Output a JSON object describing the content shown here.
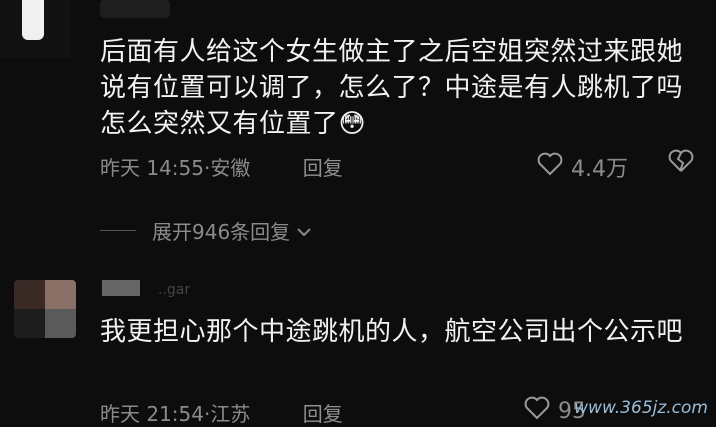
{
  "comment1": {
    "text": "后面有人给这个女生做主了之后空姐突然过来跟她说有位置可以调了，怎么了？中途是有人跳机了吗怎么突然又有位置了",
    "emoji": "😳",
    "time": "昨天 14:55",
    "location": "安徽",
    "reply_label": "回复",
    "likes": "4.4万"
  },
  "expand": {
    "label": "展开946条回复"
  },
  "comment2": {
    "username_fragment": "..gar",
    "text": "我更担心那个中途跳机的人，航空公司出个公示吧",
    "time": "昨天 21:54",
    "location": "江苏",
    "reply_label": "回复",
    "likes": "95"
  },
  "watermark": "www.365jz.com"
}
